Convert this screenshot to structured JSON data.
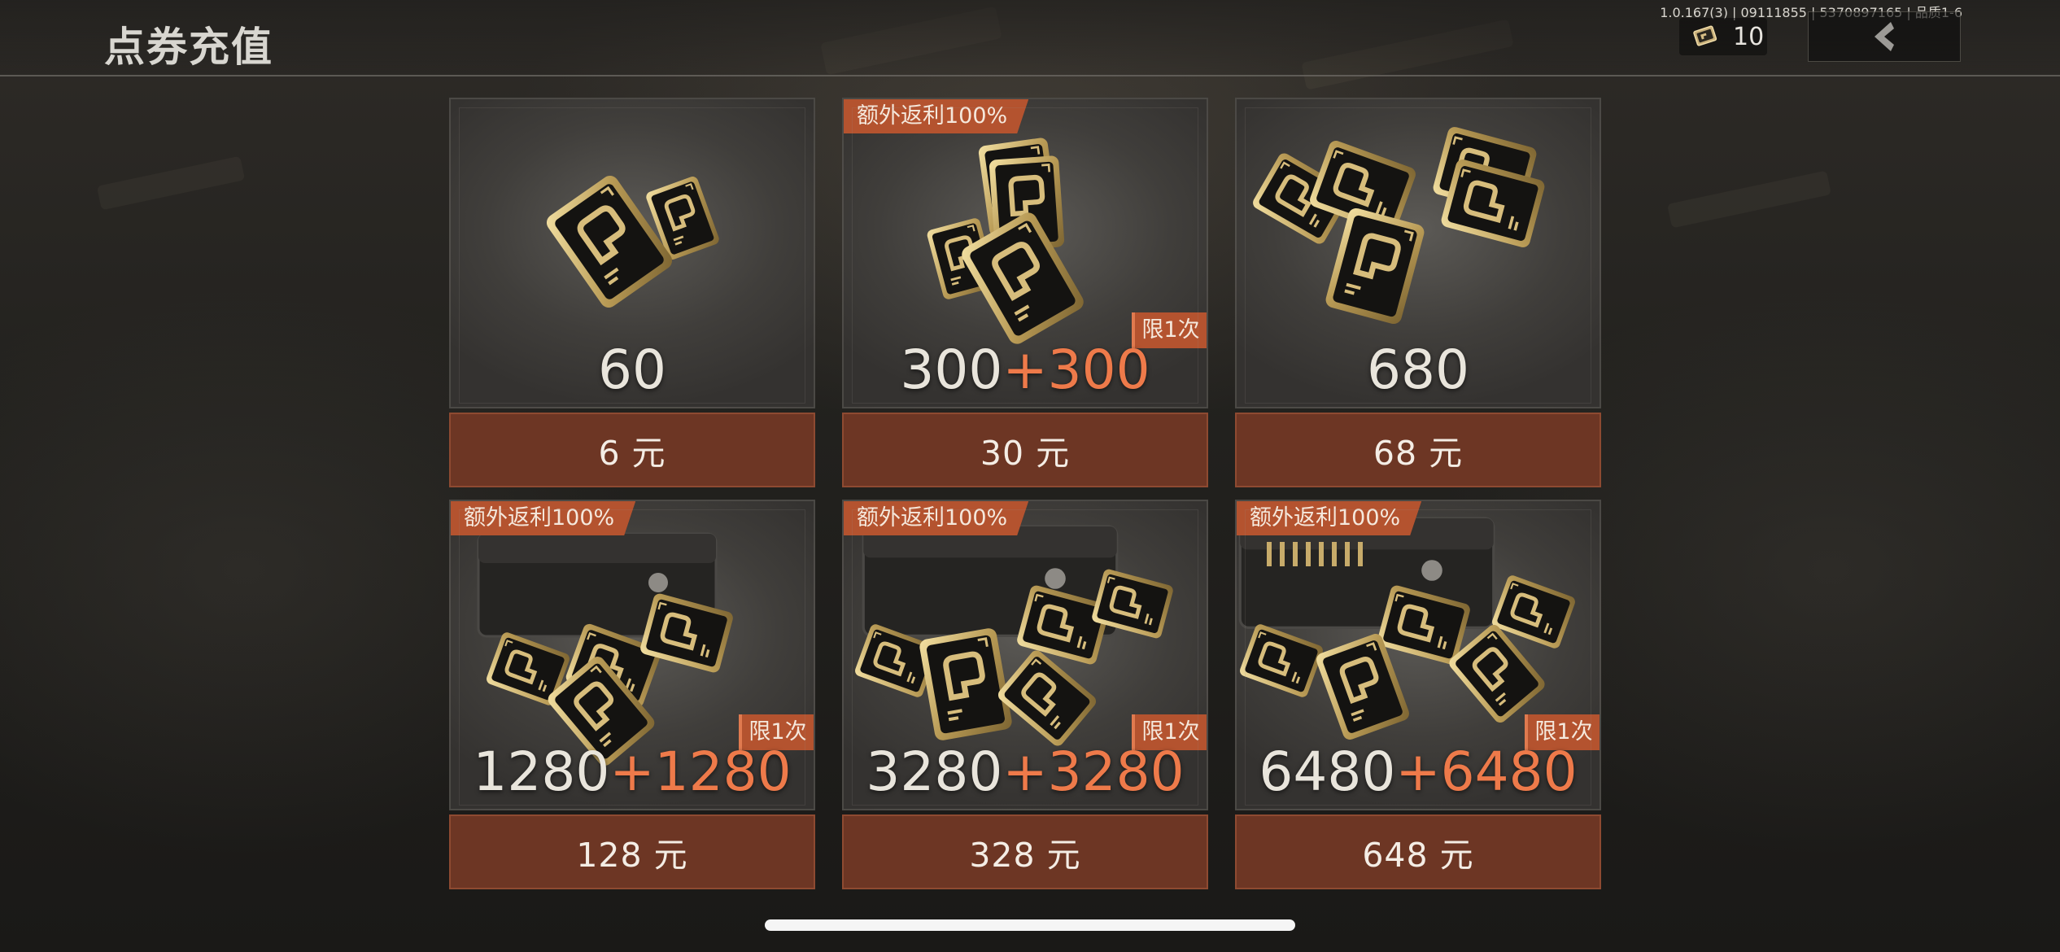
{
  "header": {
    "title": "点券充值",
    "version": "1.0.167(3) | 09111855 | 5370897165 | 品质1-6",
    "currency_count": "10",
    "currency_icon": "voucher-icon",
    "back_icon": "chevron-left-icon"
  },
  "colors": {
    "accent": "#b4532f",
    "bonus_text": "#ee7a4a",
    "price_button": "#6d3624"
  },
  "packages": [
    {
      "amount": "60",
      "bonus": "",
      "price": "6 元",
      "bonus_tag": "",
      "limit_tag": ""
    },
    {
      "amount": "300",
      "bonus": "+300",
      "price": "30 元",
      "bonus_tag": "额外返利100%",
      "limit_tag": "限1次"
    },
    {
      "amount": "680",
      "bonus": "",
      "price": "68 元",
      "bonus_tag": "",
      "limit_tag": ""
    },
    {
      "amount": "1280",
      "bonus": "+1280",
      "price": "128 元",
      "bonus_tag": "额外返利100%",
      "limit_tag": "限1次"
    },
    {
      "amount": "3280",
      "bonus": "+3280",
      "price": "328 元",
      "bonus_tag": "额外返利100%",
      "limit_tag": "限1次"
    },
    {
      "amount": "6480",
      "bonus": "+6480",
      "price": "648 元",
      "bonus_tag": "额外返利100%",
      "limit_tag": "限1次"
    }
  ]
}
